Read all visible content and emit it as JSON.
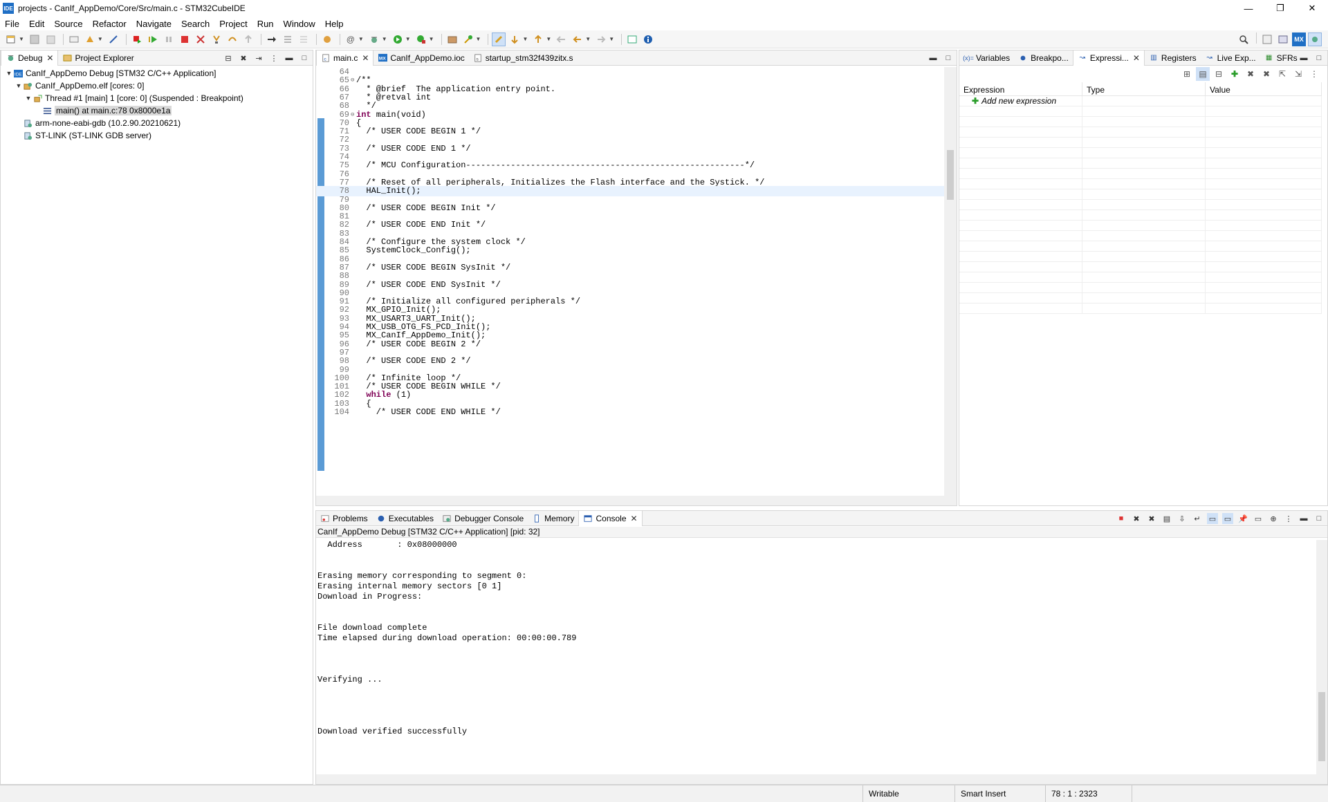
{
  "window": {
    "title": "projects - CanIf_AppDemo/Core/Src/main.c - STM32CubeIDE",
    "app_icon_text": "IDE",
    "minimize": "—",
    "restore": "❐",
    "close": "✕"
  },
  "menu": [
    "File",
    "Edit",
    "Source",
    "Refactor",
    "Navigate",
    "Search",
    "Project",
    "Run",
    "Window",
    "Help"
  ],
  "debug_panel": {
    "tabs": [
      {
        "label": "Debug",
        "icon": "debug-icon"
      },
      {
        "label": "Project Explorer",
        "icon": "project-explorer-icon"
      }
    ],
    "tree": [
      {
        "label": "CanIf_AppDemo Debug [STM32 C/C++ Application]",
        "level": 0,
        "expanded": true,
        "icon": "launch-icon"
      },
      {
        "label": "CanIf_AppDemo.elf [cores: 0]",
        "level": 1,
        "expanded": true,
        "icon": "process-icon"
      },
      {
        "label": "Thread #1 [main] 1 [core: 0] (Suspended : Breakpoint)",
        "level": 2,
        "expanded": true,
        "icon": "thread-icon"
      },
      {
        "label": "main() at main.c:78 0x8000e1a",
        "level": 3,
        "selected": true,
        "icon": "stack-frame-icon"
      },
      {
        "label": "arm-none-eabi-gdb (10.2.90.20210621)",
        "level": 1,
        "icon": "gdb-icon"
      },
      {
        "label": "ST-LINK (ST-LINK GDB server)",
        "level": 1,
        "icon": "stlink-icon"
      }
    ]
  },
  "editor": {
    "tabs": [
      {
        "label": "main.c",
        "icon": "c-file-icon",
        "active": true
      },
      {
        "label": "CanIf_AppDemo.ioc",
        "icon": "mx-file-icon"
      },
      {
        "label": "startup_stm32f439zitx.s",
        "icon": "asm-file-icon"
      }
    ],
    "current_line": 78,
    "lines": [
      {
        "n": "64",
        "t": ""
      },
      {
        "n": "65",
        "t": "/**",
        "cls": "c-doc",
        "fold": "⊖"
      },
      {
        "n": "66",
        "t": "  * @brief  The application entry point.",
        "cls": "c-doc"
      },
      {
        "n": "67",
        "t": "  * @retval int",
        "cls": "c-doc"
      },
      {
        "n": "68",
        "t": "  */",
        "cls": "c-doc"
      },
      {
        "n": "69",
        "t": "int main(void)",
        "fold": "⊖",
        "kw": true
      },
      {
        "n": "70",
        "t": "{"
      },
      {
        "n": "71",
        "t": "  /* USER CODE BEGIN 1 */",
        "cls": "c-comment"
      },
      {
        "n": "72",
        "t": ""
      },
      {
        "n": "73",
        "t": "  /* USER CODE END 1 */",
        "cls": "c-comment"
      },
      {
        "n": "74",
        "t": ""
      },
      {
        "n": "75",
        "t": "  /* MCU Configuration--------------------------------------------------------*/",
        "cls": "c-comment"
      },
      {
        "n": "76",
        "t": ""
      },
      {
        "n": "77",
        "t": "  /* Reset of all peripherals, Initializes the Flash interface and the Systick. */",
        "cls": "c-comment"
      },
      {
        "n": "78",
        "t": "  HAL_Init();"
      },
      {
        "n": "79",
        "t": ""
      },
      {
        "n": "80",
        "t": "  /* USER CODE BEGIN Init */",
        "cls": "c-comment"
      },
      {
        "n": "81",
        "t": ""
      },
      {
        "n": "82",
        "t": "  /* USER CODE END Init */",
        "cls": "c-comment"
      },
      {
        "n": "83",
        "t": ""
      },
      {
        "n": "84",
        "t": "  /* Configure the system clock */",
        "cls": "c-comment"
      },
      {
        "n": "85",
        "t": "  SystemClock_Config();"
      },
      {
        "n": "86",
        "t": ""
      },
      {
        "n": "87",
        "t": "  /* USER CODE BEGIN SysInit */",
        "cls": "c-comment"
      },
      {
        "n": "88",
        "t": ""
      },
      {
        "n": "89",
        "t": "  /* USER CODE END SysInit */",
        "cls": "c-comment"
      },
      {
        "n": "90",
        "t": ""
      },
      {
        "n": "91",
        "t": "  /* Initialize all configured peripherals */",
        "cls": "c-comment"
      },
      {
        "n": "92",
        "t": "  MX_GPIO_Init();"
      },
      {
        "n": "93",
        "t": "  MX_USART3_UART_Init();"
      },
      {
        "n": "94",
        "t": "  MX_USB_OTG_FS_PCD_Init();"
      },
      {
        "n": "95",
        "t": "  MX_CanIf_AppDemo_Init();"
      },
      {
        "n": "96",
        "t": "  /* USER CODE BEGIN 2 */",
        "cls": "c-comment"
      },
      {
        "n": "97",
        "t": ""
      },
      {
        "n": "98",
        "t": "  /* USER CODE END 2 */",
        "cls": "c-comment"
      },
      {
        "n": "99",
        "t": ""
      },
      {
        "n": "100",
        "t": "  /* Infinite loop */",
        "cls": "c-comment"
      },
      {
        "n": "101",
        "t": "  /* USER CODE BEGIN WHILE */",
        "cls": "c-comment"
      },
      {
        "n": "102",
        "t": "  while (1)",
        "kw2": true
      },
      {
        "n": "103",
        "t": "  {"
      },
      {
        "n": "104",
        "t": "    /* USER CODE END WHILE */",
        "cls": "c-comment"
      }
    ]
  },
  "expressions_panel": {
    "tabs": [
      {
        "label": "Variables",
        "icon": "variables-icon"
      },
      {
        "label": "Breakpo...",
        "icon": "breakpoints-icon"
      },
      {
        "label": "Expressi...",
        "icon": "expressions-icon",
        "active": true
      },
      {
        "label": "Registers",
        "icon": "registers-icon"
      },
      {
        "label": "Live Exp...",
        "icon": "live-expressions-icon"
      },
      {
        "label": "SFRs",
        "icon": "sfrs-icon"
      }
    ],
    "columns": [
      "Expression",
      "Type",
      "Value"
    ],
    "add_label": "Add new expression"
  },
  "console_panel": {
    "tabs": [
      {
        "label": "Problems",
        "icon": "problems-icon"
      },
      {
        "label": "Executables",
        "icon": "executables-icon"
      },
      {
        "label": "Debugger Console",
        "icon": "debugger-console-icon"
      },
      {
        "label": "Memory",
        "icon": "memory-icon"
      },
      {
        "label": "Console",
        "icon": "console-icon",
        "active": true
      }
    ],
    "subtitle": "CanIf_AppDemo Debug [STM32 C/C++ Application]  [pid: 32]",
    "output": "  Address       : 0x08000000\n\n\nErasing memory corresponding to segment 0:\nErasing internal memory sectors [0 1]\nDownload in Progress:\n\n\nFile download complete\nTime elapsed during download operation: 00:00:00.789\n\n\n\nVerifying ...\n\n\n\n\nDownload verified successfully"
  },
  "statusbar": {
    "writable": "Writable",
    "insert_mode": "Smart Insert",
    "position": "78 : 1 : 2323"
  }
}
